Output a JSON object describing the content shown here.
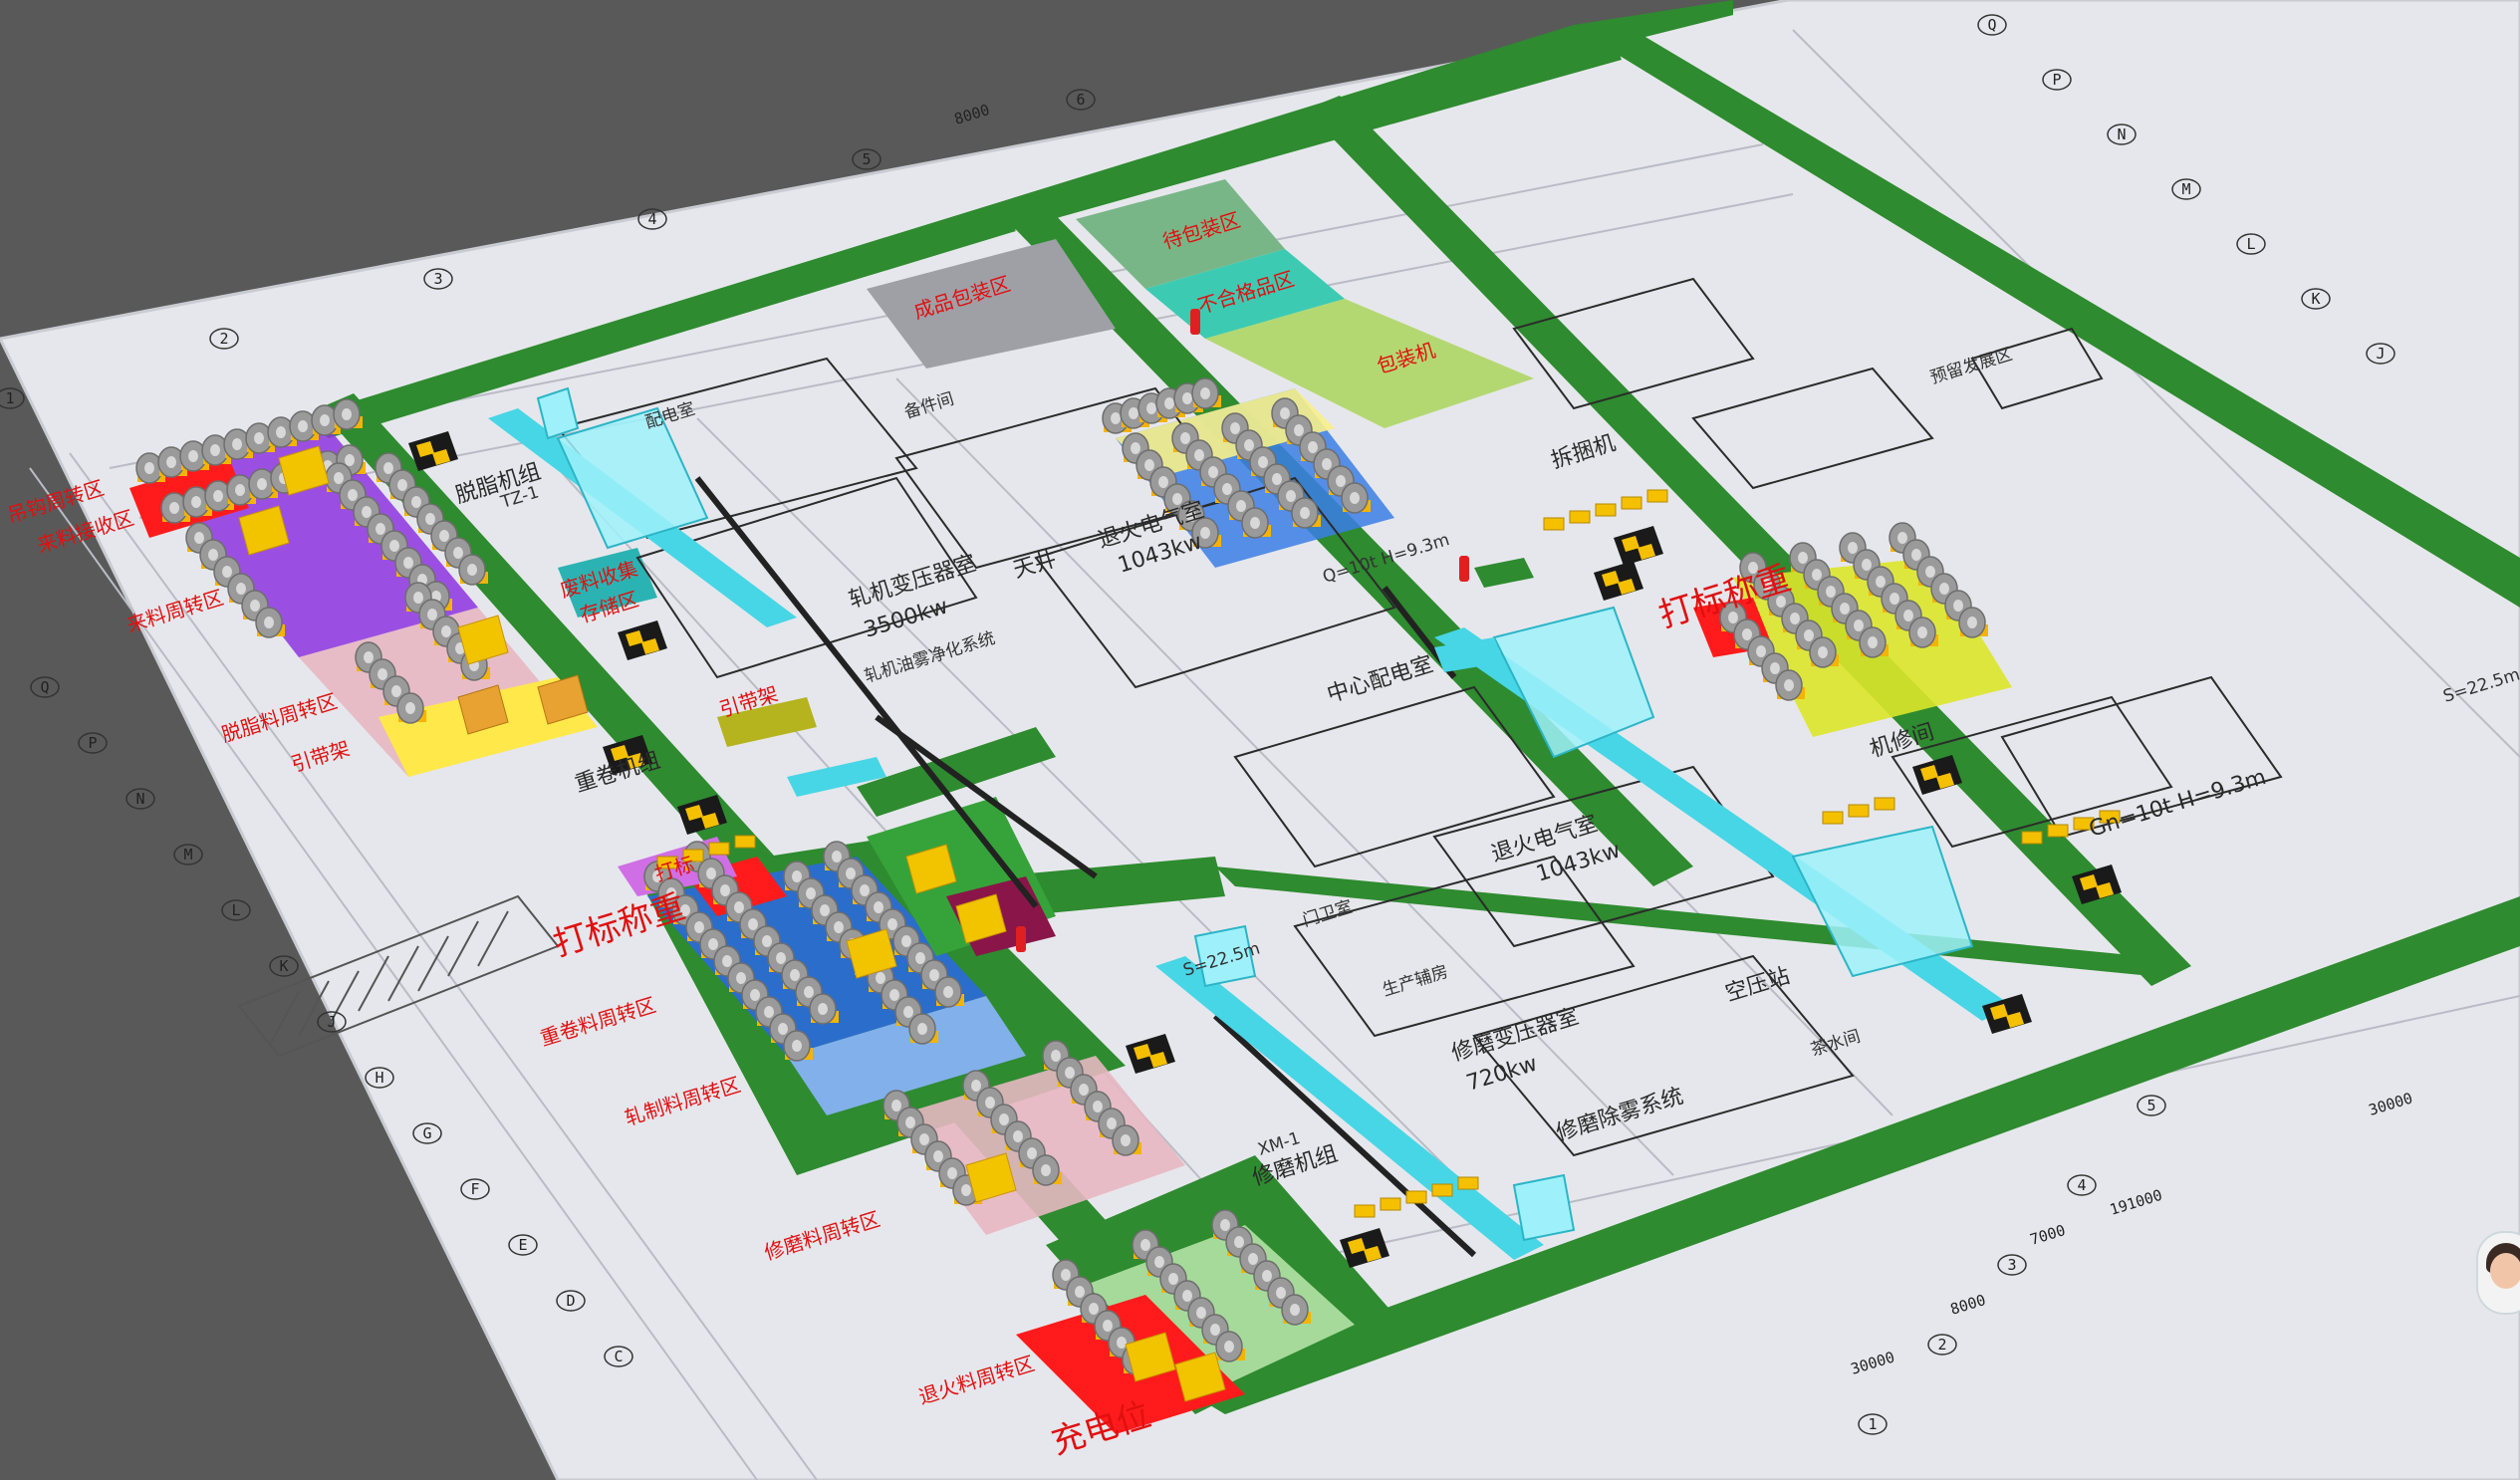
{
  "scene": {
    "colors": {
      "background": "#595959",
      "paper": "#e6e7ec",
      "road": "#2e8b2f",
      "coil": "#9a9a9a",
      "pallet": "#f5b400",
      "cyan_equipment": "#47d6e6"
    }
  },
  "zones": {
    "left_column": [
      {
        "label": "吊钩周转区"
      },
      {
        "label": "来料接收区"
      },
      {
        "label": "来料周转区"
      },
      {
        "label": "脱脂料周转区"
      },
      {
        "label": "引带架"
      },
      {
        "label": "打标称重"
      },
      {
        "label": "重卷料周转区"
      },
      {
        "label": "轧制料周转区"
      },
      {
        "label": "修磨料周转区"
      },
      {
        "label": "退火料周转区"
      },
      {
        "label": "充电位"
      }
    ],
    "right_side": [
      {
        "label": "打标称重"
      }
    ],
    "top_blocks": [
      {
        "label": "成品包装区"
      },
      {
        "label": "待包装区"
      },
      {
        "label": "不合格品区"
      },
      {
        "label": "包装机"
      }
    ],
    "inner": [
      {
        "label": "废料收集"
      },
      {
        "label": "存储区"
      },
      {
        "label": "引带架"
      },
      {
        "label": "打标"
      }
    ]
  },
  "plan_labels": [
    {
      "text": "脱脂机组"
    },
    {
      "text": "TZ-1"
    },
    {
      "text": "配电室"
    },
    {
      "text": "备件间"
    },
    {
      "text": "轧机变压器室"
    },
    {
      "text": "3500kw"
    },
    {
      "text": "天井"
    },
    {
      "text": "退火电气室"
    },
    {
      "text": "1043kw"
    },
    {
      "text": "轧机油雾净化系统"
    },
    {
      "text": "中心配电室"
    },
    {
      "text": "重卷机组"
    },
    {
      "text": "修磨机组"
    },
    {
      "text": "XM-1"
    },
    {
      "text": "修磨变压器室"
    },
    {
      "text": "720kw"
    },
    {
      "text": "修磨除雾系统"
    },
    {
      "text": "生产辅房"
    },
    {
      "text": "空压站"
    },
    {
      "text": "茶水间"
    },
    {
      "text": "退火电气室"
    },
    {
      "text": "1043kw"
    },
    {
      "text": "Gn=10t  H=9.3m"
    },
    {
      "text": "Q=10t  H=9.3m"
    },
    {
      "text": "S=22.5m"
    },
    {
      "text": "S=22.5m"
    },
    {
      "text": "门卫室"
    },
    {
      "text": "机修间"
    },
    {
      "text": "拆捆机"
    },
    {
      "text": "预留发展区"
    }
  ],
  "axes": {
    "left_letters": [
      "Q",
      "P",
      "N",
      "M",
      "L",
      "K",
      "J",
      "H",
      "G",
      "F",
      "E",
      "D",
      "C"
    ],
    "top_numbers": [
      "1",
      "2",
      "3",
      "4",
      "5",
      "6"
    ],
    "bottom_numbers": [
      "1",
      "2",
      "3",
      "4",
      "5"
    ],
    "right_letters": [
      "Q",
      "P",
      "N",
      "M",
      "L",
      "K",
      "J"
    ],
    "dims": [
      "30000",
      "8000",
      "7000",
      "191000",
      "30000",
      "8000"
    ]
  }
}
